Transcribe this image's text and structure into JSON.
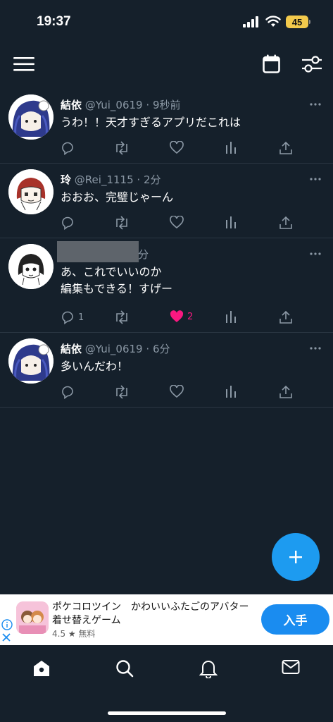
{
  "status_bar": {
    "time": "19:37",
    "battery": "45"
  },
  "colors": {
    "background": "#15202b",
    "accent": "#1d9bf0",
    "like": "#f91880",
    "muted": "#8b98a5"
  },
  "topbar": {
    "left_icon": "menu-icon",
    "right_icons": [
      "calendar-icon",
      "filter-icon"
    ]
  },
  "tweets": [
    {
      "name": "結依",
      "handle": "@Yui_0619",
      "time": "9秒前",
      "lines": [
        "うわ！！天才すぎるアプリだこれは"
      ],
      "replies": "",
      "likes": "",
      "liked": false
    },
    {
      "name": "玲",
      "handle": "@Rei_1115",
      "time": "2分",
      "lines": [
        "おおお、完璧じゃーん"
      ],
      "replies": "",
      "likes": "",
      "liked": false
    },
    {
      "name": "",
      "handle": "",
      "time": "分",
      "lines": [
        "あ、これでいいのか",
        "編集もできる！すげー"
      ],
      "replies": "1",
      "likes": "2",
      "liked": true
    },
    {
      "name": "結依",
      "handle": "@Yui_0619",
      "time": "6分",
      "lines": [
        "多いんだわ！"
      ],
      "replies": "",
      "likes": "",
      "liked": false
    }
  ],
  "ad": {
    "title_line1": "ポケコロツイン　かわいいふたごのアバター",
    "title_line2": "着せ替えゲーム",
    "rating": "4.5",
    "price": "無料",
    "button": "入手"
  },
  "fab": {
    "icon": "plus-icon"
  },
  "bottom_nav": [
    "home-icon",
    "search-icon",
    "bell-icon",
    "mail-icon"
  ]
}
